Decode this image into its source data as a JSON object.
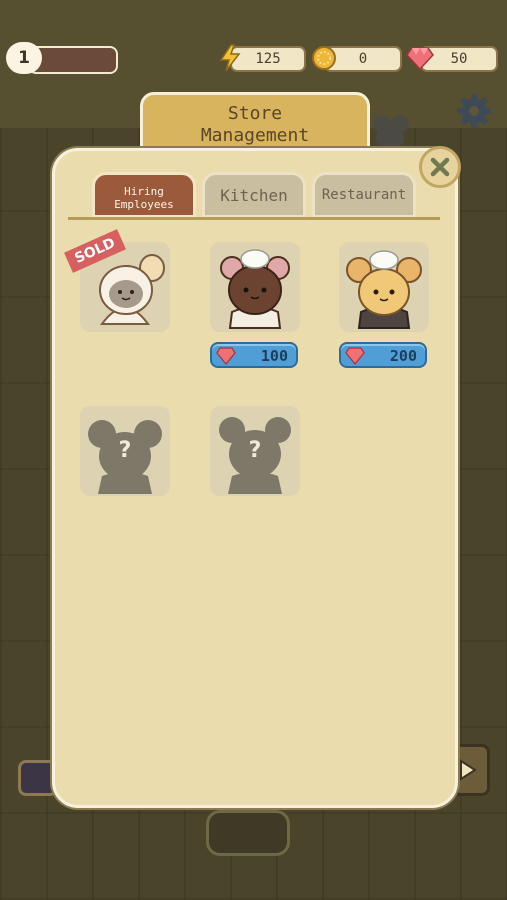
{
  "hud": {
    "level": "1",
    "energy": "125",
    "coins": "0",
    "gems": "50"
  },
  "panel": {
    "title_line1": "Store",
    "title_line2": "Management",
    "tabs": [
      {
        "label_line1": "Hiring",
        "label_line2": "Employees",
        "active": true
      },
      {
        "label": "Kitchen",
        "active": false
      },
      {
        "label": "Restaurant",
        "active": false
      }
    ],
    "employees": [
      {
        "name": "cat-employee",
        "status": "sold",
        "badge": "SOLD"
      },
      {
        "name": "brown-bear-chef",
        "price": "100"
      },
      {
        "name": "yellow-mouse-chef",
        "price": "200"
      },
      {
        "name": "locked-employee-1",
        "locked_label": "?"
      },
      {
        "name": "locked-employee-2",
        "locked_label": "?"
      }
    ]
  },
  "colors": {
    "panel_bg": "#ebdcae",
    "tab_active": "#9c5a3c",
    "price_blue": "#4f9fd6",
    "sold_red": "#d66060"
  }
}
